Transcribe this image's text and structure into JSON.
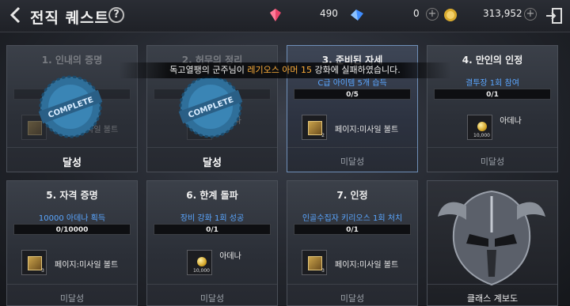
{
  "header": {
    "title": "전직 퀘스트",
    "help": "?",
    "gems": "490",
    "crystals": "0",
    "gold": "313,952",
    "plus": "+"
  },
  "toast": {
    "prefix": "독고열팽의 군주님이 ",
    "item": "레기오스 아머 15",
    "suffix": " 강화에 실패하였습니다."
  },
  "cards": [
    {
      "title": "1. 인내의 증명",
      "reward": "페이지:미사일 볼트",
      "status": "달성"
    },
    {
      "title": "2. 허무의 정리",
      "reward": "아데나",
      "status": "달성"
    },
    {
      "title": "3. 준비된 자세",
      "desc": "C급 아이템 5개 습득",
      "progress": "0/5",
      "reward": "페이지:미사일 볼트",
      "count": "2",
      "status": "미달성"
    },
    {
      "title": "4. 만인의 인정",
      "desc": "결투장 1회 참여",
      "progress": "0/1",
      "reward": "아데나",
      "count": "10,000",
      "status": "미달성"
    },
    {
      "title": "5. 자격 증명",
      "desc": "10000 아데나 획득",
      "progress": "0/10000",
      "reward": "페이지:미사일 볼트",
      "count": "3",
      "status": "미달성"
    },
    {
      "title": "6. 한계 돌파",
      "desc": "장비 강화 1회 성공",
      "progress": "0/1",
      "reward": "아데나",
      "count": "10,000",
      "status": "미달성"
    },
    {
      "title": "7. 인정",
      "desc": "인골수집자 키리오스 1회 처치",
      "progress": "0/1",
      "reward": "페이지:미사일 볼트",
      "count": "3",
      "status": "미달성"
    }
  ],
  "class_tree": {
    "label": "클래스 계보도"
  },
  "stamp_text": "COMPLETE"
}
